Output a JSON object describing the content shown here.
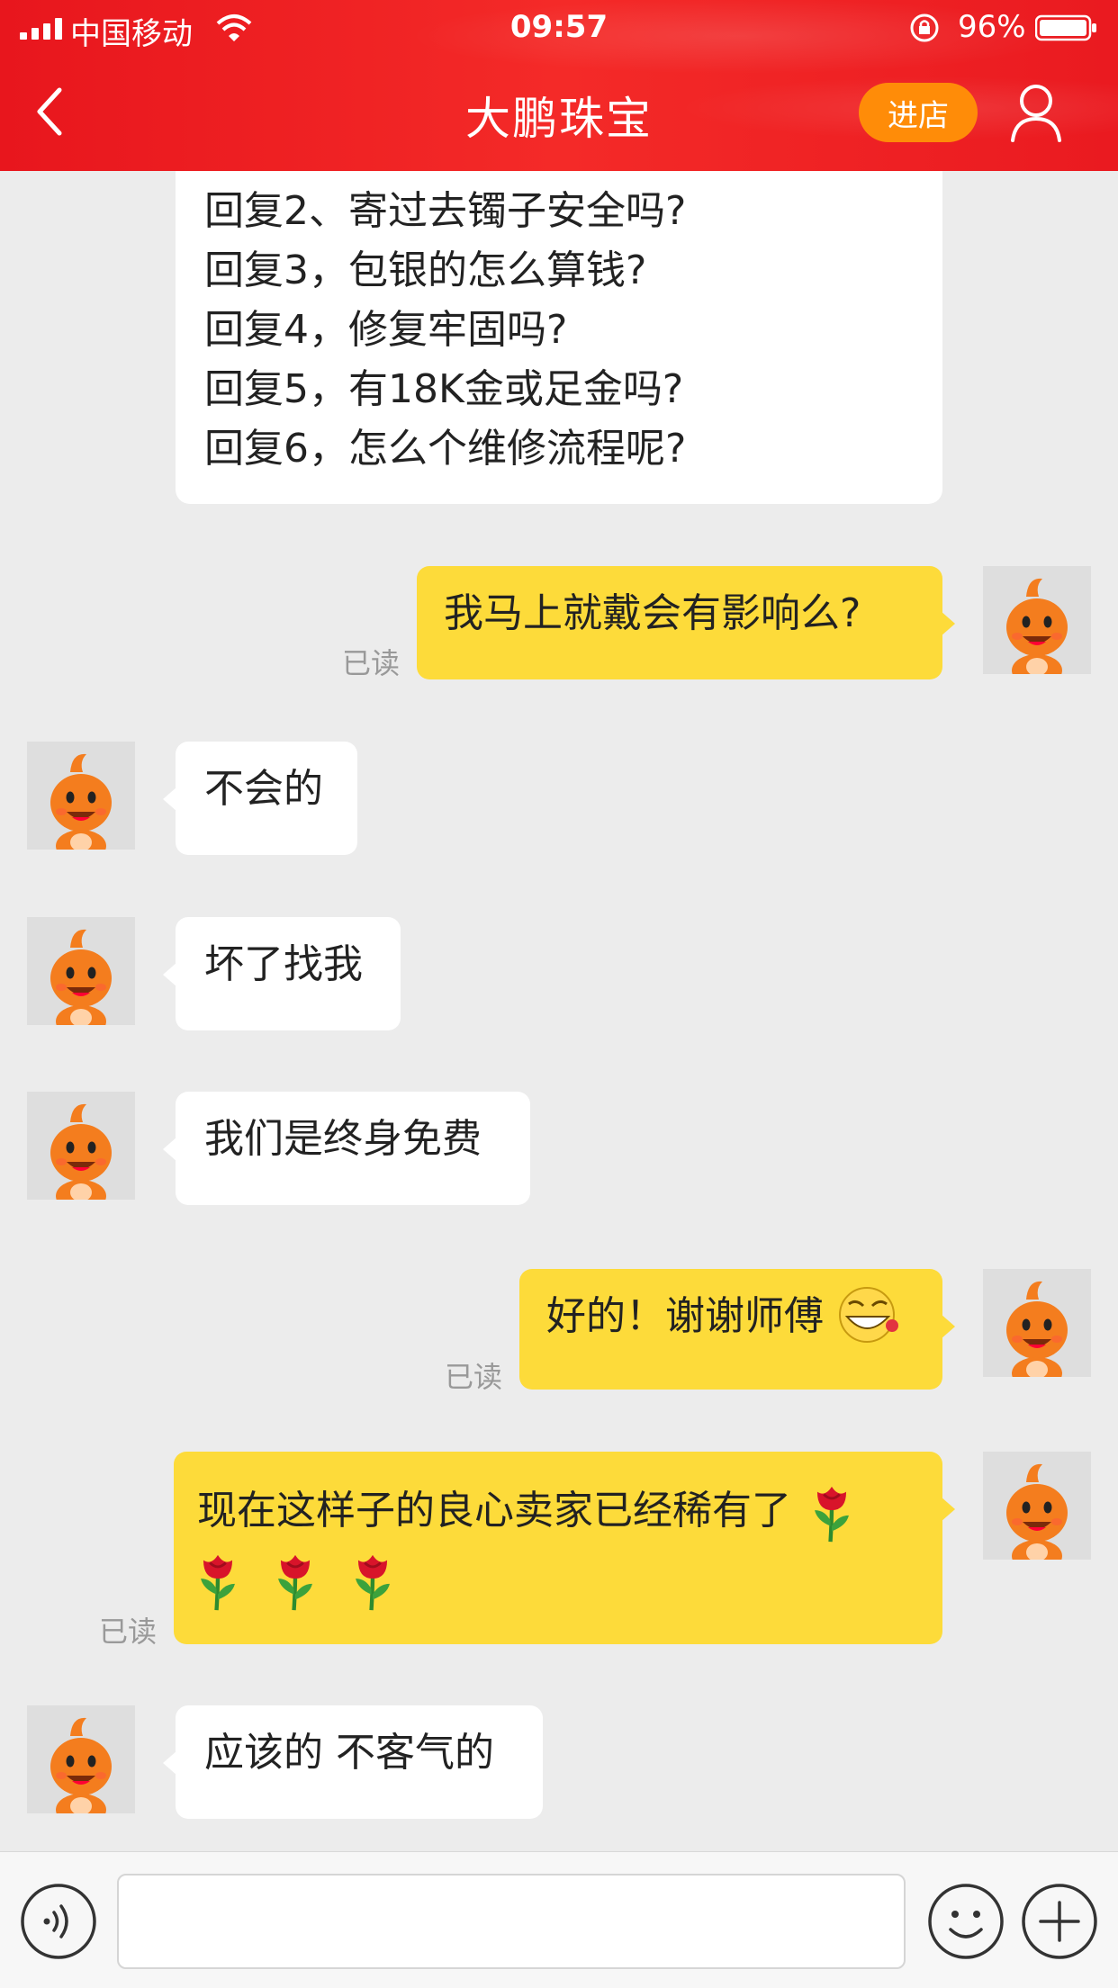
{
  "status_bar": {
    "carrier": "中国移动",
    "time": "09:57",
    "battery": "96%"
  },
  "header": {
    "title": "大鹏珠宝",
    "enter_store": "进店"
  },
  "messages": {
    "list_lines": [
      "回复2、寄过去镯子安全吗?",
      "回复3，包银的怎么算钱?",
      "回复4，修复牢固吗?",
      "回复5，有18K金或足金吗?",
      "回复6，怎么个维修流程呢?"
    ],
    "m1": "我马上就戴会有影响么?",
    "m2": "不会的",
    "m3": "坏了找我",
    "m4": "我们是终身免费",
    "m5": "好的！谢谢师傅",
    "m6": "现在这样子的良心卖家已经稀有了",
    "m7": "应该的 不客气的",
    "read_label": "已读"
  },
  "colors": {
    "header_red": "#ee1c23",
    "enter_orange": "#ff8c08",
    "sent_bubble": "#fddb3a"
  },
  "icons": [
    "back-icon",
    "user-icon",
    "voice-icon",
    "smile-icon",
    "plus-icon",
    "rose-icon",
    "grin-emoji-icon"
  ],
  "input": {
    "value": "",
    "placeholder": ""
  }
}
